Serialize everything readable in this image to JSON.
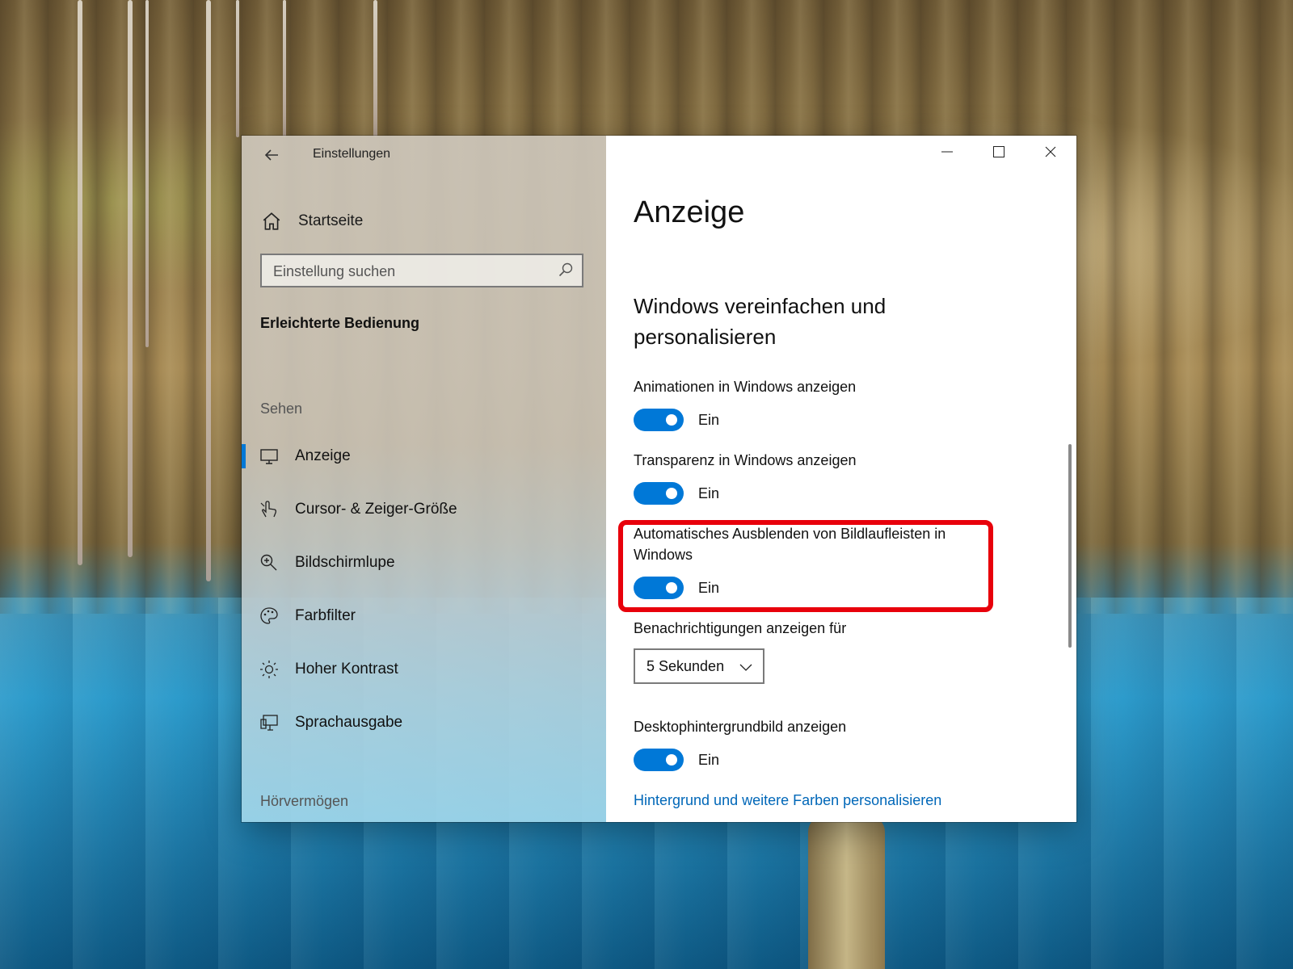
{
  "window": {
    "title": "Einstellungen",
    "controls": {
      "minimize": "minimize-icon",
      "maximize": "maximize-icon",
      "close": "close-icon"
    }
  },
  "sidebar": {
    "home_label": "Startseite",
    "search_placeholder": "Einstellung suchen",
    "category": "Erleichterte Bedienung",
    "groups": [
      {
        "title": "Sehen",
        "items": [
          {
            "label": "Anzeige",
            "icon": "monitor-icon",
            "active": true
          },
          {
            "label": "Cursor- & Zeiger-Größe",
            "icon": "cursor-icon",
            "active": false
          },
          {
            "label": "Bildschirmlupe",
            "icon": "magnifier-icon",
            "active": false
          },
          {
            "label": "Farbfilter",
            "icon": "palette-icon",
            "active": false
          },
          {
            "label": "Hoher Kontrast",
            "icon": "brightness-icon",
            "active": false
          },
          {
            "label": "Sprachausgabe",
            "icon": "narrator-icon",
            "active": false
          }
        ]
      },
      {
        "title": "Hörvermögen",
        "items": []
      }
    ]
  },
  "main": {
    "page_title": "Anzeige",
    "section_title": "Windows vereinfachen und personalisieren",
    "settings": [
      {
        "label": "Animationen in Windows anzeigen",
        "toggle_text": "Ein",
        "on": true
      },
      {
        "label": "Transparenz in Windows anzeigen",
        "toggle_text": "Ein",
        "on": true
      },
      {
        "label": "Automatisches Ausblenden von Bildlaufleisten in Windows",
        "toggle_text": "Ein",
        "on": true,
        "highlighted": true
      },
      {
        "label": "Desktophintergrundbild anzeigen",
        "toggle_text": "Ein",
        "on": true
      }
    ],
    "notifications": {
      "label": "Benachrichtigungen anzeigen für",
      "value": "5 Sekunden"
    },
    "link": "Hintergrund und weitere Farben personalisieren"
  },
  "colors": {
    "accent": "#0078d7",
    "highlight": "#e8000b",
    "link": "#0067b8"
  }
}
